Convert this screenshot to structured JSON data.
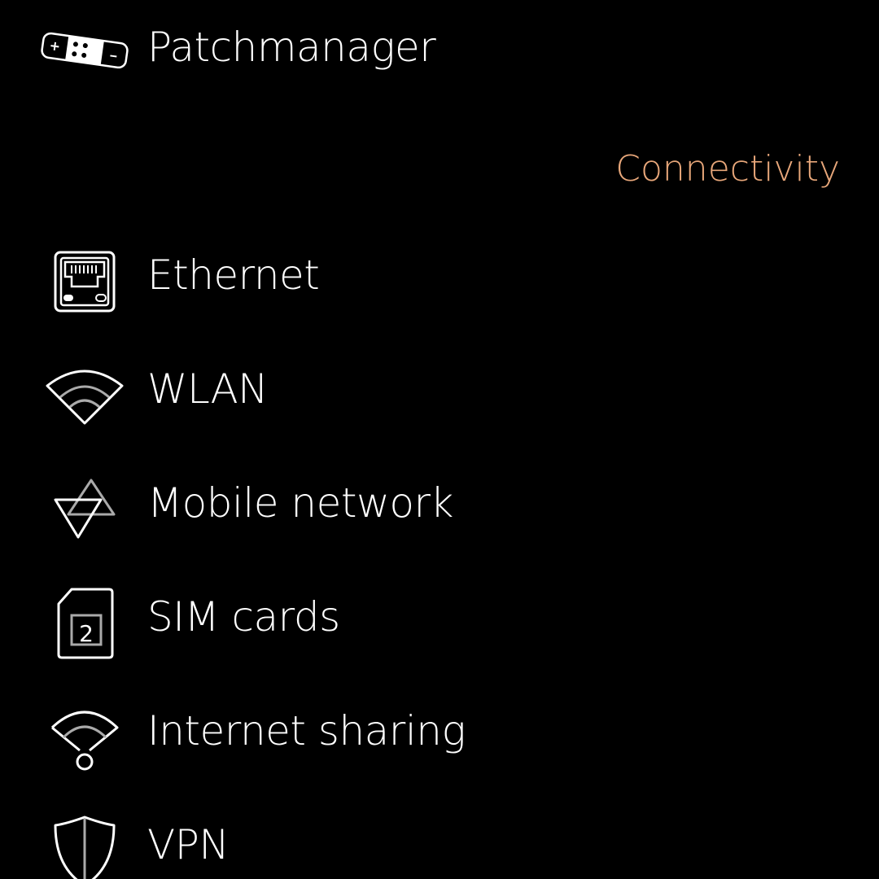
{
  "colors": {
    "background": "#000000",
    "text": "#ffffff",
    "section_header": "#e8a77a",
    "icon_secondary": "#aaaaaa"
  },
  "top_item": {
    "label": "Patchmanager",
    "icon": "patch-bandage-icon"
  },
  "section": {
    "title": "Connectivity"
  },
  "items": [
    {
      "label": "Ethernet",
      "icon": "ethernet-port-icon"
    },
    {
      "label": "WLAN",
      "icon": "wifi-icon"
    },
    {
      "label": "Mobile network",
      "icon": "mobile-network-icon"
    },
    {
      "label": "SIM cards",
      "icon": "sim-card-icon",
      "badge": "2"
    },
    {
      "label": "Internet sharing",
      "icon": "internet-sharing-icon"
    },
    {
      "label": "VPN",
      "icon": "vpn-shield-icon"
    }
  ]
}
